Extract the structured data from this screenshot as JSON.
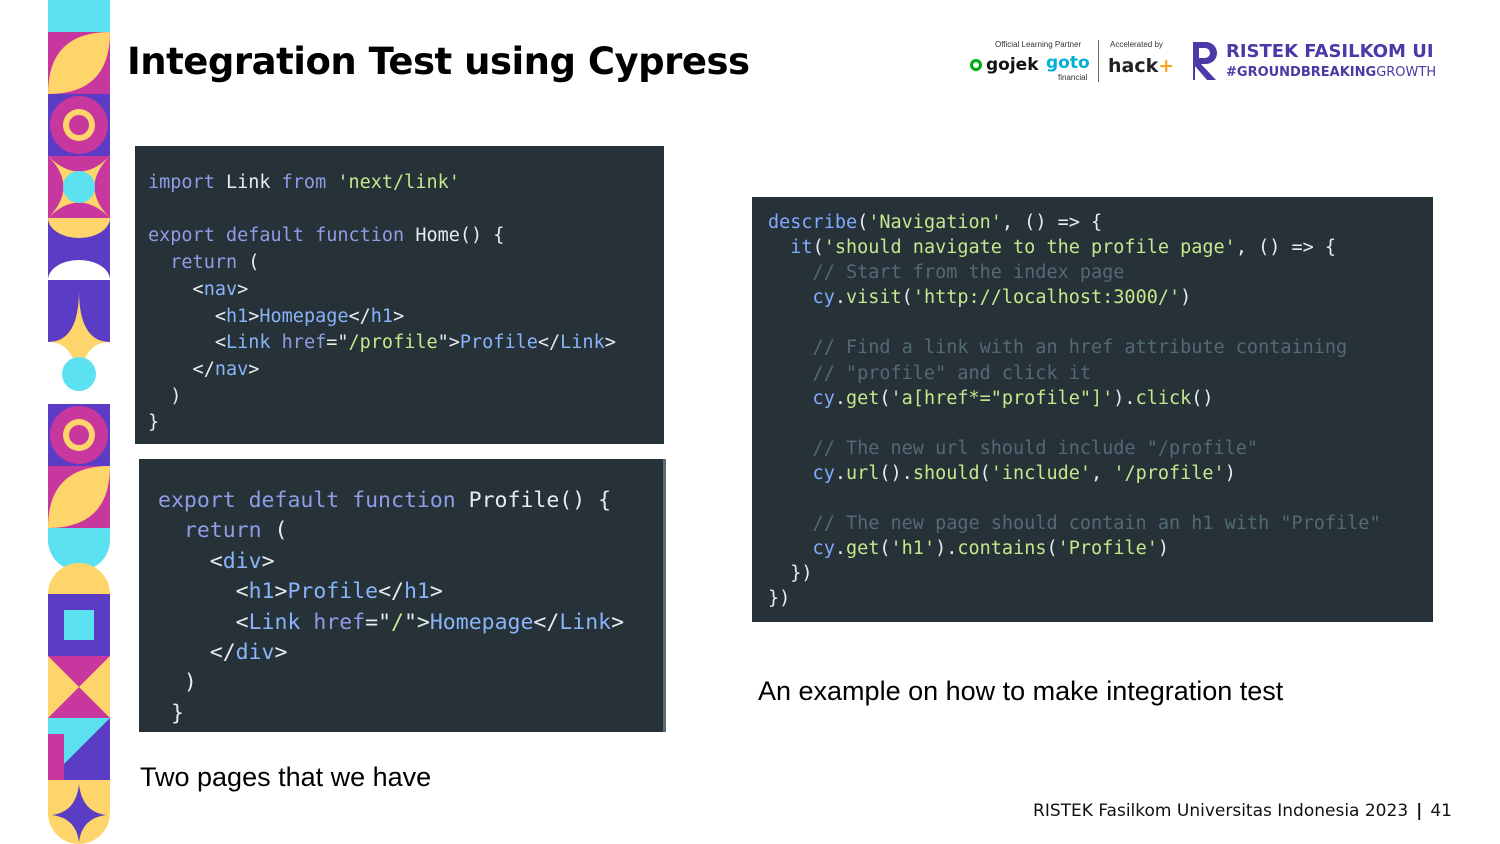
{
  "slide": {
    "title": "Integration Test using Cypress",
    "caption_left": "Two pages that we have",
    "caption_right": "An example on how to make integration test",
    "footer": {
      "org": "RISTEK Fasilkom Universitas Indonesia 2023",
      "page": "41"
    }
  },
  "header_logos": {
    "partner_label": "Official Learning Partner",
    "accelerated_label": "Accelerated by",
    "gojek": "gojek",
    "goto": "goto",
    "goto_sub": "financial",
    "hack": "hack",
    "ristek": "RISTEK FASILKOM UI",
    "hashtag_bold": "#GROUNDBREAKING",
    "hashtag_rest": "GROWTH"
  },
  "code_home": [
    [
      [
        "kw",
        "import"
      ],
      [
        "txt",
        " Link "
      ],
      [
        "kw",
        "from"
      ],
      [
        "str",
        " 'next/link'"
      ]
    ],
    [],
    [
      [
        "kw",
        "export default function"
      ],
      [
        "fn",
        " Home"
      ],
      [
        "txt",
        "() {"
      ]
    ],
    [
      [
        "kw",
        "  return"
      ],
      [
        "txt",
        " ("
      ]
    ],
    [
      [
        "txt",
        "    <"
      ],
      [
        "tag-c",
        "nav"
      ],
      [
        "txt",
        ">"
      ]
    ],
    [
      [
        "txt",
        "      <"
      ],
      [
        "tag-c",
        "h1"
      ],
      [
        "txt",
        ">"
      ],
      [
        "tag-c",
        "Homepage"
      ],
      [
        "txt",
        "</"
      ],
      [
        "tag-c",
        "h1"
      ],
      [
        "txt",
        ">"
      ]
    ],
    [
      [
        "txt",
        "      <"
      ],
      [
        "tag-c",
        "Link"
      ],
      [
        "kw",
        " href"
      ],
      [
        "txt",
        "=\""
      ],
      [
        "str",
        "/profile"
      ],
      [
        "txt",
        "\">"
      ],
      [
        "tag-c",
        "Profile"
      ],
      [
        "txt",
        "</"
      ],
      [
        "tag-c",
        "Link"
      ],
      [
        "txt",
        ">"
      ]
    ],
    [
      [
        "txt",
        "    </"
      ],
      [
        "tag-c",
        "nav"
      ],
      [
        "txt",
        ">"
      ]
    ],
    [
      [
        "txt",
        "  )"
      ]
    ],
    [
      [
        "txt",
        "}"
      ]
    ]
  ],
  "code_profile": [
    [
      [
        "kw",
        "export default function"
      ],
      [
        "fn",
        " Profile"
      ],
      [
        "txt",
        "() {"
      ]
    ],
    [
      [
        "kw",
        "  return"
      ],
      [
        "txt",
        " ("
      ]
    ],
    [
      [
        "txt",
        "    <"
      ],
      [
        "tag-c",
        "div"
      ],
      [
        "txt",
        ">"
      ]
    ],
    [
      [
        "txt",
        "      <"
      ],
      [
        "tag-c",
        "h1"
      ],
      [
        "txt",
        ">"
      ],
      [
        "tag-c",
        "Profile"
      ],
      [
        "txt",
        "</"
      ],
      [
        "tag-c",
        "h1"
      ],
      [
        "txt",
        ">"
      ]
    ],
    [
      [
        "txt",
        "      <"
      ],
      [
        "tag-c",
        "Link"
      ],
      [
        "kw",
        " href"
      ],
      [
        "txt",
        "=\""
      ],
      [
        "str",
        "/"
      ],
      [
        "txt",
        "\">"
      ],
      [
        "tag-c",
        "Homepage"
      ],
      [
        "txt",
        "</"
      ],
      [
        "tag-c",
        "Link"
      ],
      [
        "txt",
        ">"
      ]
    ],
    [
      [
        "txt",
        "    </"
      ],
      [
        "tag-c",
        "div"
      ],
      [
        "txt",
        ">"
      ]
    ],
    [
      [
        "txt",
        "  )"
      ]
    ],
    [
      [
        "txt",
        " }"
      ]
    ]
  ],
  "code_test": [
    [
      [
        "obj",
        "describe"
      ],
      [
        "txt",
        "("
      ],
      [
        "str",
        "'Navigation'"
      ],
      [
        "txt",
        ", () => {"
      ]
    ],
    [
      [
        "obj",
        "  it"
      ],
      [
        "txt",
        "("
      ],
      [
        "str",
        "'should navigate to the profile page'"
      ],
      [
        "txt",
        ", () => {"
      ]
    ],
    [
      [
        "cm",
        "    // Start from the index page"
      ]
    ],
    [
      [
        "obj",
        "    cy"
      ],
      [
        "txt",
        "."
      ],
      [
        "meth",
        "visit"
      ],
      [
        "txt",
        "("
      ],
      [
        "str",
        "'http://localhost:3000/'"
      ],
      [
        "txt",
        ")"
      ]
    ],
    [],
    [
      [
        "cm",
        "    // Find a link with an href attribute containing"
      ]
    ],
    [
      [
        "cm",
        "    // \"profile\" and click it"
      ]
    ],
    [
      [
        "obj",
        "    cy"
      ],
      [
        "txt",
        "."
      ],
      [
        "meth",
        "get"
      ],
      [
        "txt",
        "("
      ],
      [
        "str",
        "'a[href*=\"profile\"]'"
      ],
      [
        "txt",
        ")."
      ],
      [
        "meth",
        "click"
      ],
      [
        "txt",
        "()"
      ]
    ],
    [],
    [
      [
        "cm",
        "    // The new url should include \"/profile\""
      ]
    ],
    [
      [
        "obj",
        "    cy"
      ],
      [
        "txt",
        "."
      ],
      [
        "meth",
        "url"
      ],
      [
        "txt",
        "()."
      ],
      [
        "meth",
        "should"
      ],
      [
        "txt",
        "("
      ],
      [
        "str",
        "'include'"
      ],
      [
        "txt",
        ", "
      ],
      [
        "str",
        "'/profile'"
      ],
      [
        "txt",
        ")"
      ]
    ],
    [],
    [
      [
        "cm",
        "    // The new page should contain an h1 with \"Profile\""
      ]
    ],
    [
      [
        "obj",
        "    cy"
      ],
      [
        "txt",
        "."
      ],
      [
        "meth",
        "get"
      ],
      [
        "txt",
        "("
      ],
      [
        "str",
        "'h1'"
      ],
      [
        "txt",
        ")."
      ],
      [
        "meth",
        "contains"
      ],
      [
        "txt",
        "("
      ],
      [
        "str",
        "'Profile'"
      ],
      [
        "txt",
        ")"
      ]
    ],
    [
      [
        "txt",
        "  })"
      ]
    ],
    [
      [
        "txt",
        "})"
      ]
    ]
  ],
  "colors": {
    "code_bg": "#263238",
    "deco_purple": "#5b3cc4",
    "deco_magenta": "#c7379d",
    "deco_yellow": "#fdd56a",
    "deco_cyan": "#5ce1f0"
  }
}
